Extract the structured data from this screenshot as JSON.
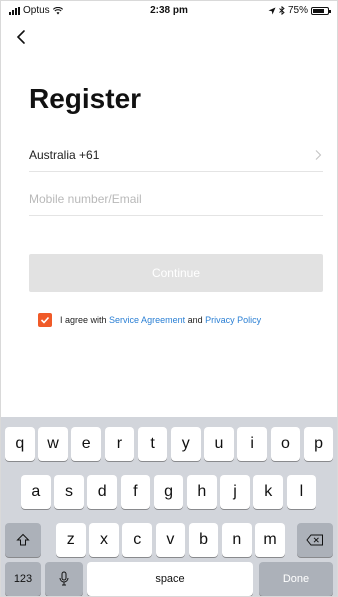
{
  "status_bar": {
    "carrier": "Optus",
    "time": "2:38 pm",
    "battery_text": "75%",
    "battery_level": 0.75
  },
  "header": {
    "back_icon": "chevron-left-icon",
    "title": "Register"
  },
  "form": {
    "country": "Australia +61",
    "mobile_placeholder": "Mobile number/Email",
    "continue_label": "Continue"
  },
  "agreement": {
    "checked": true,
    "prefix": "I agree with",
    "service_link": "Service Agreement",
    "conjunction": "and",
    "privacy_link": "Privacy Policy",
    "checkbox_color": "#f05a28",
    "link_color": "#2a7fd4"
  },
  "keyboard": {
    "row1": [
      "q",
      "w",
      "e",
      "r",
      "t",
      "y",
      "u",
      "i",
      "o",
      "p"
    ],
    "row2": [
      "a",
      "s",
      "d",
      "f",
      "g",
      "h",
      "j",
      "k",
      "l"
    ],
    "row3": [
      "z",
      "x",
      "c",
      "v",
      "b",
      "n",
      "m"
    ],
    "numbers_key": "123",
    "space_key": "space",
    "done_key": "Done"
  }
}
